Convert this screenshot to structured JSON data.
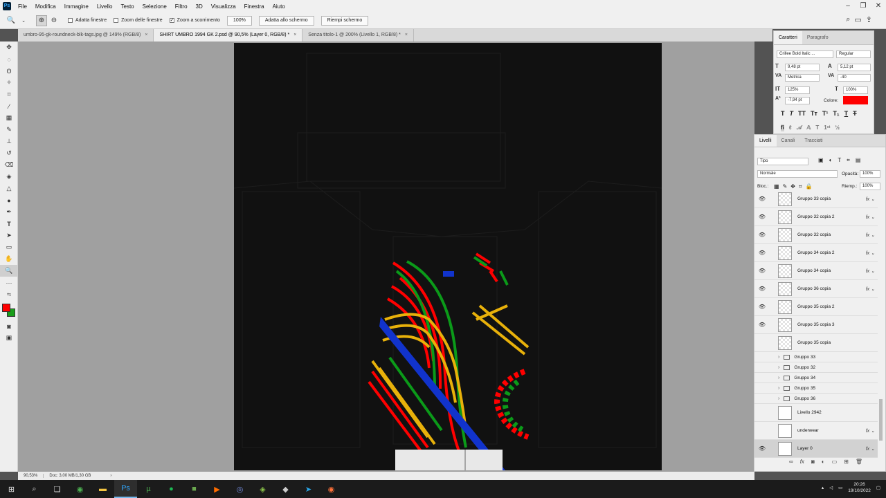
{
  "menubar": {
    "items": [
      "File",
      "Modifica",
      "Immagine",
      "Livello",
      "Testo",
      "Selezione",
      "Filtro",
      "3D",
      "Visualizza",
      "Finestra",
      "Aiuto"
    ]
  },
  "options": {
    "chk_adatta": "Adatta finestre",
    "chk_zoom_all": "Zoom delle finestre",
    "chk_scrub": "Zoom a scorrimento",
    "zoom_value": "100%",
    "btn_fit": "Adatta allo schermo",
    "btn_fill": "Riempi schermo"
  },
  "tabs": [
    "umbro-95-gk-roundneck-blk-tags.jpg @ 149% (RGB/8)",
    "SHIRT UMBRO 1994 GK 2.psd @ 90,5% (Layer 0, RGB/8) *",
    "Senza titolo-1 @ 200% (Livello 1, RGB/8) *"
  ],
  "status": {
    "zoom": "90,53%",
    "doc": "Doc: 3,00 MB/1,30 GB"
  },
  "character": {
    "tab_char": "Caratteri",
    "tab_para": "Paragrafo",
    "font_family": "Crillee Bold Italic ...",
    "font_style": "Regular",
    "font_size": "9,48 pt",
    "leading": "5,12 pt",
    "kerning": "Metrica",
    "tracking": "-40",
    "vscale": "125%",
    "hscale": "100%",
    "baseline": "-7,94 pt",
    "color_label": "Colore:",
    "color": "#ff0000"
  },
  "layers": {
    "tab_layers": "Livelli",
    "tab_channels": "Canali",
    "tab_paths": "Tracciati",
    "filter": "Tipo",
    "blend": "Normale",
    "opacity_label": "Opacità:",
    "opacity": "100%",
    "lock_label": "Bloc.:",
    "fill_label": "Riemp.:",
    "fill": "100%",
    "rows": [
      {
        "name": "Gruppo 33 copia",
        "visible": true,
        "fx": true
      },
      {
        "name": "Gruppo 32 copia 2",
        "visible": true,
        "fx": true
      },
      {
        "name": "Gruppo 32 copia",
        "visible": true,
        "fx": true
      },
      {
        "name": "Gruppo 34 copia 2",
        "visible": true,
        "fx": true
      },
      {
        "name": "Gruppo 34 copia",
        "visible": true,
        "fx": true
      },
      {
        "name": "Gruppo 36 copia",
        "visible": true,
        "fx": true
      },
      {
        "name": "Gruppo 35 copia 2",
        "visible": true,
        "fx": false
      },
      {
        "name": "Gruppo 35 copia 3",
        "visible": true,
        "fx": false
      },
      {
        "name": "Gruppo 35 copia",
        "visible": false,
        "fx": false
      }
    ],
    "groups": [
      "Gruppo 33",
      "Gruppo 32",
      "Gruppo 34",
      "Gruppo 35",
      "Gruppo 36"
    ],
    "bottom_rows": [
      {
        "name": "Livello 2942",
        "visible": false,
        "fx": false
      },
      {
        "name": "underwear",
        "visible": false,
        "fx": true
      },
      {
        "name": "Layer 0",
        "visible": true,
        "fx": true
      }
    ]
  },
  "taskbar": {
    "time": "20:26",
    "date": "19/10/2022"
  }
}
